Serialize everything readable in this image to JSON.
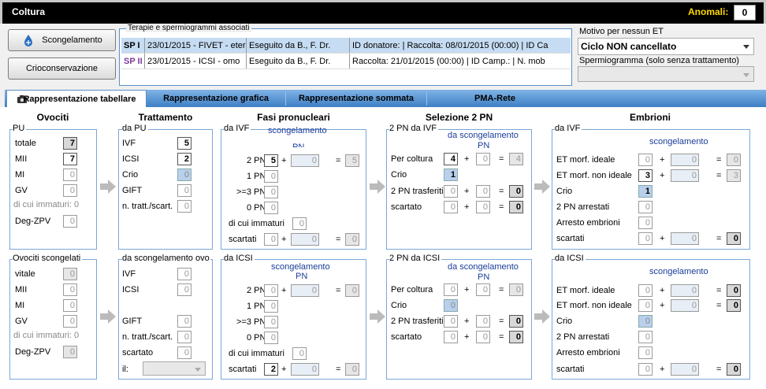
{
  "title": "Coltura",
  "anomali_label": "Anomali:",
  "anomali_value": "0",
  "buttons": {
    "scongelamento": "Scongelamento",
    "crioconservazione": "Crioconservazione"
  },
  "terapie": {
    "legend": "Terapie e spermiogrammi associati",
    "rows": [
      {
        "sp": "SP I",
        "therapy": "23/01/2015 - FIVET - eter",
        "exec": "Eseguito da B., F. Dr.",
        "detail": "ID donatore:  | Raccolta: 08/01/2015 (00:00)  | ID Ca"
      },
      {
        "sp": "SP II",
        "therapy": "23/01/2015 - ICSI - omo",
        "exec": "Eseguito da B., F. Dr.",
        "detail": "Raccolta: 21/01/2015 (00:00)  | ID Camp.:  | N. mob"
      }
    ]
  },
  "motivo": {
    "label": "Motivo per nessun ET",
    "value": "Ciclo NON cancellato",
    "sperm_label": "Spermiogramma (solo senza trattamento)",
    "sperm_value": ""
  },
  "tabs": [
    "Rappresentazione tabellare",
    "Rappresentazione grafica",
    "Rappresentazione sommata",
    "PMA-Rete"
  ],
  "headers": {
    "ovociti": "Ovociti",
    "trattamento": "Trattamento",
    "fasi": "Fasi pronucleari",
    "selezione": "Selezione 2 PN",
    "embrioni": "Embrioni"
  },
  "ovociti_pu": {
    "legend": "PU",
    "totale": "totale",
    "totale_v": "7",
    "mii": "MII",
    "mii_v": "7",
    "mi": "MI",
    "mi_v": "0",
    "gv": "GV",
    "gv_v": "0",
    "immaturi": "di cui immaturi: 0",
    "deg": "Deg-ZPV",
    "deg_v": "0"
  },
  "ovociti_sc": {
    "legend": "Ovociti scongelati",
    "vitale": "vitale",
    "vitale_v": "0",
    "mii": "MII",
    "mii_v": "0",
    "mi": "MI",
    "mi_v": "0",
    "gv": "GV",
    "gv_v": "0",
    "immaturi": "di cui immaturi: 0",
    "deg": "Deg-ZPV",
    "deg_v": "0"
  },
  "tratt_pu": {
    "legend": "da PU",
    "ivf": "IVF",
    "ivf_v": "5",
    "icsi": "ICSI",
    "icsi_v": "2",
    "crio": "Crio",
    "crio_v": "0",
    "gift": "GIFT",
    "gift_v": "0",
    "ntratt": "n. tratt./scart.",
    "ntratt_v": "0"
  },
  "tratt_sc": {
    "legend": "da scongelamento ovo",
    "ivf": "IVF",
    "ivf_v": "0",
    "icsi": "ICSI",
    "icsi_v": "0",
    "gift": "GIFT",
    "gift_v": "0",
    "ntratt": "n. tratt./scart.",
    "ntratt_v": "0",
    "scartato": "scartato",
    "scartato_v": "0",
    "il": "il:"
  },
  "fasi_ivf": {
    "legend": "da IVF",
    "sc": "scongelamento",
    "pn": "PN",
    "pn2": "2 PN",
    "pn2_a": "5",
    "pn2_b": "0",
    "pn2_t": "5",
    "pn1": "1 PN",
    "pn1_v": "0",
    "pn3": ">=3 PN",
    "pn3_v": "0",
    "pn0": "0 PN",
    "pn0_v": "0",
    "imm": "di cui immaturi",
    "imm_v": "0",
    "scart": "scartati",
    "scart_a": "0",
    "scart_b": "0",
    "scart_t": "0"
  },
  "fasi_icsi": {
    "legend": "da ICSI",
    "sc": "scongelamento",
    "pn": "PN",
    "pn2": "2 PN",
    "pn2_a": "0",
    "pn2_b": "0",
    "pn2_t": "0",
    "pn1": "1 PN",
    "pn1_v": "0",
    "pn3": ">=3 PN",
    "pn3_v": "0",
    "pn0": "0 PN",
    "pn0_v": "0",
    "imm": "di cui immaturi",
    "imm_v": "0",
    "scart": "scartati",
    "scart_a": "2",
    "scart_b": "0",
    "scart_t": "0"
  },
  "sel_ivf": {
    "legend": "2 PN da IVF",
    "sc": "da scongelamento",
    "pn": "PN",
    "coltura": "Per coltura",
    "coltura_a": "4",
    "coltura_b": "0",
    "coltura_t": "4",
    "crio": "Crio",
    "crio_v": "1",
    "trasf": "2 PN trasferiti",
    "trasf_a": "0",
    "trasf_b": "0",
    "trasf_t": "0",
    "scart": "scartato",
    "scart_a": "0",
    "scart_b": "0",
    "scart_t": "0"
  },
  "sel_icsi": {
    "legend": "2 PN da ICSI",
    "sc": "da scongelamento",
    "pn": "PN",
    "coltura": "Per coltura",
    "coltura_a": "0",
    "coltura_b": "0",
    "coltura_t": "0",
    "crio": "Crio",
    "crio_v": "0",
    "trasf": "2 PN trasferiti",
    "trasf_a": "0",
    "trasf_b": "0",
    "trasf_t": "0",
    "scart": "scartato",
    "scart_a": "0",
    "scart_b": "0",
    "scart_t": "0"
  },
  "emb_ivf": {
    "legend": "da IVF",
    "sc": "scongelamento",
    "etid": "ET morf. ideale",
    "etid_a": "0",
    "etid_b": "0",
    "etid_t": "0",
    "etnid": "ET morf. non ideale",
    "etnid_a": "3",
    "etnid_b": "0",
    "etnid_t": "3",
    "crio": "Crio",
    "crio_v": "1",
    "arr": "2 PN arrestati",
    "arr_v": "0",
    "arremb": "Arresto embrioni",
    "arremb_v": "0",
    "scart": "scartati",
    "scart_a": "0",
    "scart_b": "0",
    "scart_t": "0"
  },
  "emb_icsi": {
    "legend": "da ICSI",
    "sc": "scongelamento",
    "etid": "ET morf. ideale",
    "etid_a": "0",
    "etid_b": "0",
    "etid_t": "0",
    "etnid": "ET morf. non ideale",
    "etnid_a": "0",
    "etnid_b": "0",
    "etnid_t": "0",
    "crio": "Crio",
    "crio_v": "0",
    "arr": "2 PN arrestati",
    "arr_v": "0",
    "arremb": "Arresto embrioni",
    "arremb_v": "0",
    "scart": "scartati",
    "scart_a": "0",
    "scart_b": "0",
    "scart_t": "0"
  },
  "ops": {
    "plus": "+",
    "eq": "="
  }
}
